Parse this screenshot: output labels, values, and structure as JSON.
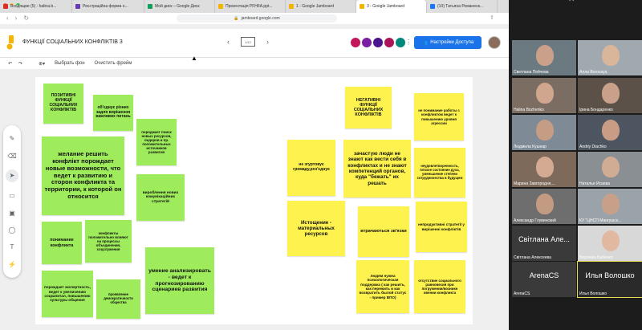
{
  "browser": {
    "tabs": [
      {
        "label": "Входящие (5) - halina.b...",
        "color": "#d93025"
      },
      {
        "label": "Реєстраційна форма н...",
        "color": "#673ab7"
      },
      {
        "label": "Мой диск – Google Диск",
        "color": "#0f9d58"
      },
      {
        "label": "Презентація PFHIIA.ppt...",
        "color": "#f4b400"
      },
      {
        "label": "1 - Google Jamboard",
        "color": "#f4b400"
      },
      {
        "label": "3 - Google Jamboard",
        "color": "#f4b400"
      },
      {
        "label": "(10) Татьяна Романенк...",
        "color": "#1877f2"
      }
    ],
    "url": "jamboard.google.com"
  },
  "header": {
    "title": "ФУНКЦІЇ СОЦІАЛЬНИХ КОНФЛІКТІВ 3",
    "frame_indicator": "1/12",
    "share_label": "Настройки Доступа"
  },
  "toolbar": {
    "set_background": "Выбрать фон",
    "clear_frame": "Очистить фрейм"
  },
  "notes": [
    {
      "text": "ПОЗИТИВНІ ФУНКЦІЇ СОЦІАЛЬНИХ КОНФЛІКТІВ",
      "color": "green"
    },
    {
      "text": "об'єднує різних задля вирішення важливих питань",
      "color": "green"
    },
    {
      "text": "породжает поиск новых ресурсов, лидеров и пр. положительных источников развития",
      "color": "green"
    },
    {
      "text": "желание решить конфлікт порождает новые возможности, что ведет к развитию и сторон конфликта та территории, к которой он относится",
      "color": "green"
    },
    {
      "text": "вироблення нових комунікаційних стратегій",
      "color": "green"
    },
    {
      "text": "понимание конфликта",
      "color": "green"
    },
    {
      "text": "конфликты положительно влияют на процессы объединения, соцслужения",
      "color": "green"
    },
    {
      "text": "умение анализировать - ведет к прогнозированию сценариев развития",
      "color": "green"
    },
    {
      "text": "порождает экспертность, ведет к увеличению соцкапитал, повышению культуры общения",
      "color": "green"
    },
    {
      "text": "проявление демократичности общества",
      "color": "green"
    },
    {
      "text": "НЕГАТИВНІ ФУНКЦІЇ СОЦІАЛЬНИХ КОНФЛІКТІВ",
      "color": "yellow"
    },
    {
      "text": "не понимание работы с конфликтом ведет к повышению уровня агрессии",
      "color": "yellow"
    },
    {
      "text": "не згуртовує громаду,роз'єднує",
      "color": "yellow"
    },
    {
      "text": "зачастую люди не знают как вести себя в конфликтах и не знают компетенций органов, куда \"бежать\" их решать",
      "color": "yellow"
    },
    {
      "text": "неудовлетворенность, плохое состояние духа, уменьшение степени сотрудничества в будущем",
      "color": "yellow"
    },
    {
      "text": "Истощение - материальных ресурсов",
      "color": "yellow"
    },
    {
      "text": "втрачаються зв'язки",
      "color": "yellow"
    },
    {
      "text": "непродуктивні стратегії у вирішенні конфліктів",
      "color": "yellow"
    },
    {
      "text": "людям нужна психологическая поддержка ( как решить, как пережить и как возвратить былой статус - пример ВПО)",
      "color": "yellow"
    },
    {
      "text": "отсутствие социального равновесия при погружении/возникн овении конфликта",
      "color": "yellow"
    }
  ],
  "participants": [
    {
      "name": "Светлана Пейчева",
      "bg": "#6b7a80",
      "face": "#caa08a"
    },
    {
      "name": "Алла Borovaya",
      "bg": "#a0a8b0",
      "face": "#d9b59a"
    },
    {
      "name": "Halina Bozhenko",
      "bg": "#7c6d63",
      "face": "#d0a68e"
    },
    {
      "name": "Ірина Бондаренко",
      "bg": "#5c5148",
      "face": "#c9a18a"
    },
    {
      "name": "Людмила Кушнар",
      "bg": "#7e8a96",
      "face": "#c59c84"
    },
    {
      "name": "Andriy Diachko",
      "bg": "#4d5660",
      "face": "#c99d85"
    },
    {
      "name": "Марина Завгородня,...",
      "bg": "#7d6a5a",
      "face": "#d4ab92"
    },
    {
      "name": "Наталье Исаева",
      "bg": "#8a8f94",
      "face": "#d1ac94"
    },
    {
      "name": "Александр Глувинский",
      "bg": "#6e6e6e",
      "face": "#c39a82"
    },
    {
      "name": "КУ \"ЦНСП Мангушск...",
      "bg": "#9aa3aa",
      "face": "#c8a08a"
    },
    {
      "name": "Світлана Але...",
      "bg": "#3a3a3a",
      "face": ""
    },
    {
      "name": "Вероніка Бабенко",
      "bg": "#d8d8d8",
      "face": "#e0b9a0"
    },
    {
      "name": "ArenaCS",
      "bg": "#3a3a3a",
      "face": ""
    },
    {
      "name": "Илья Волошко",
      "bg": "#2a2a2a",
      "face": ""
    }
  ],
  "participant_labels": {
    "svitlana_big": "Світлана Але...",
    "svitlana_full": "Світлана Алексеева",
    "arena_big": "ArenaCS",
    "arena_small": "ArenaCS",
    "ilya_big": "Илья Волошко",
    "ilya_small": "Илья Волошко"
  }
}
